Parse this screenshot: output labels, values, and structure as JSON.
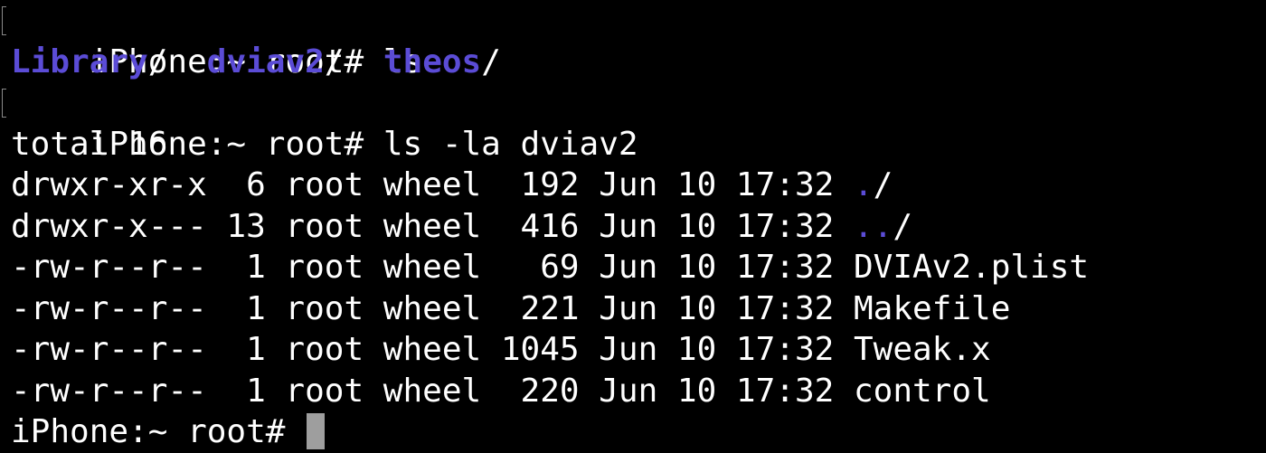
{
  "terminal": {
    "prompt": "iPhone:~ root# ",
    "cmd1": "ls",
    "ls_output": [
      {
        "name": "Library",
        "slash": "/"
      },
      {
        "name": "dviav2",
        "slash": "/"
      },
      {
        "name": "theos",
        "slash": "/"
      }
    ],
    "cmd2": "ls -la dviav2",
    "total": "total 16",
    "rows": [
      {
        "prefix": "drwxr-xr-x  6 root wheel  192 Jun 10 17:32 ",
        "name": ".",
        "suffix": "/"
      },
      {
        "prefix": "drwxr-x--- 13 root wheel  416 Jun 10 17:32 ",
        "name": "..",
        "suffix": "/"
      },
      {
        "prefix": "-rw-r--r--  1 root wheel   69 Jun 10 17:32 ",
        "name": "DVIAv2.plist",
        "suffix": ""
      },
      {
        "prefix": "-rw-r--r--  1 root wheel  221 Jun 10 17:32 ",
        "name": "Makefile",
        "suffix": ""
      },
      {
        "prefix": "-rw-r--r--  1 root wheel 1045 Jun 10 17:32 ",
        "name": "Tweak.x",
        "suffix": ""
      },
      {
        "prefix": "-rw-r--r--  1 root wheel  220 Jun 10 17:32 ",
        "name": "control",
        "suffix": ""
      }
    ],
    "final_prompt": "iPhone:~ root# ",
    "colors": {
      "background": "#000000",
      "foreground": "#ffffff",
      "directory": "#5b4cd6",
      "cursor": "#9e9e9e"
    }
  }
}
